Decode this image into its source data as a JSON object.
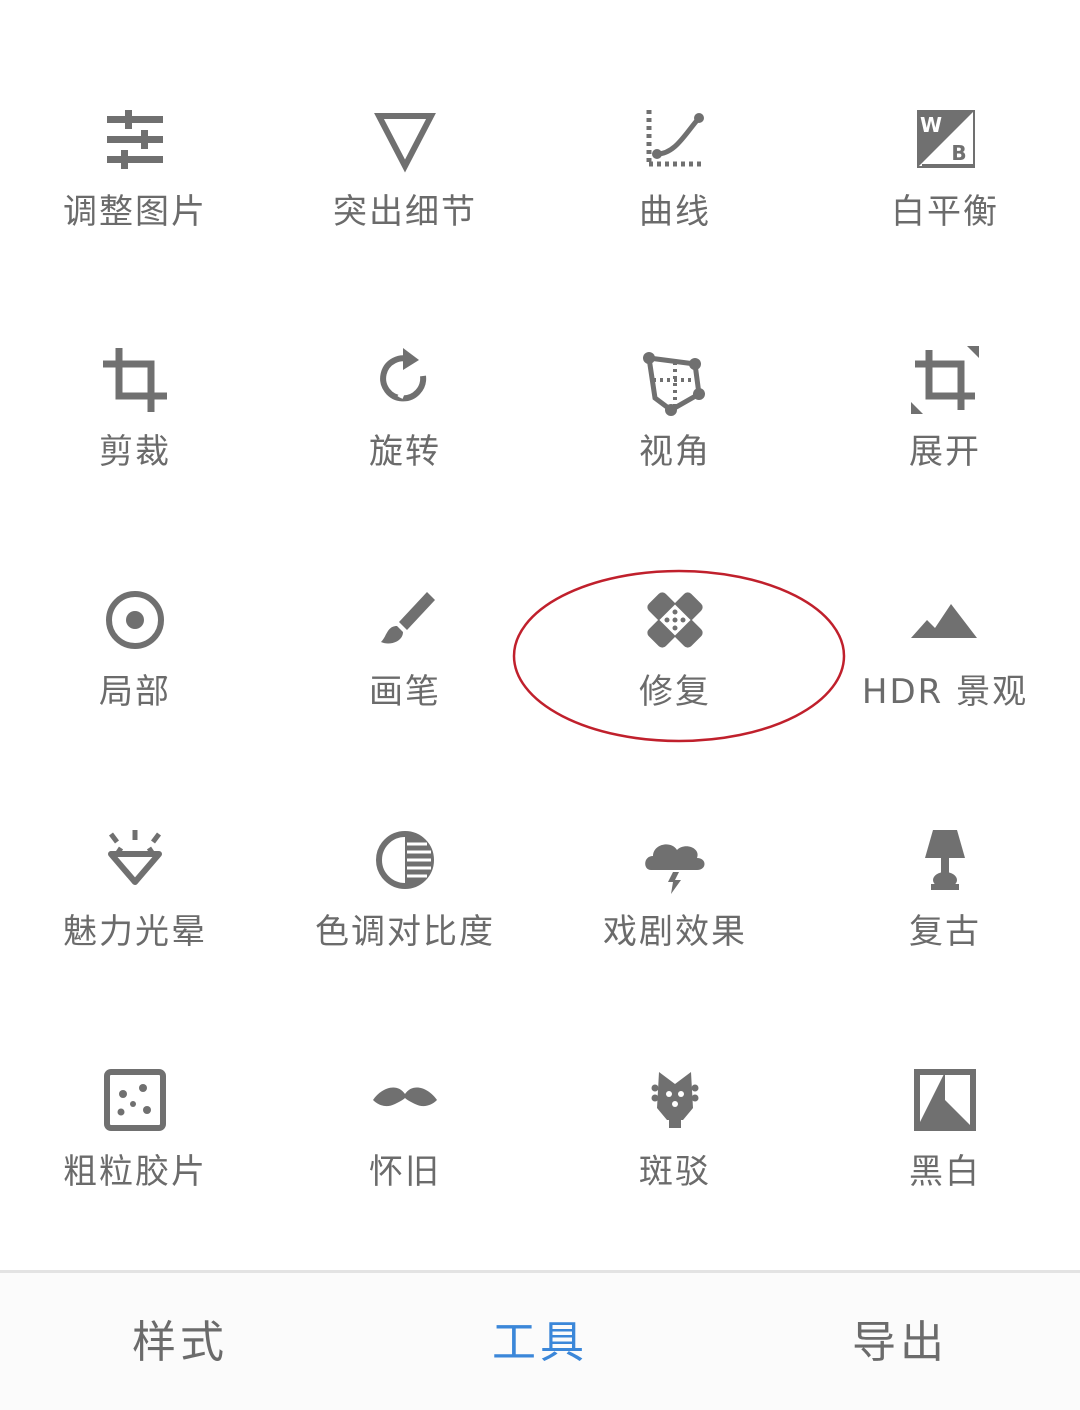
{
  "tools": [
    {
      "label": "调整图片",
      "icon": "tune-sliders-icon"
    },
    {
      "label": "突出细节",
      "icon": "details-triangle-icon"
    },
    {
      "label": "曲线",
      "icon": "curves-icon"
    },
    {
      "label": "白平衡",
      "icon": "white-balance-icon"
    },
    {
      "label": "剪裁",
      "icon": "crop-icon"
    },
    {
      "label": "旋转",
      "icon": "rotate-icon"
    },
    {
      "label": "视角",
      "icon": "perspective-icon"
    },
    {
      "label": "展开",
      "icon": "expand-icon"
    },
    {
      "label": "局部",
      "icon": "selective-target-icon"
    },
    {
      "label": "画笔",
      "icon": "brush-icon"
    },
    {
      "label": "修复",
      "icon": "healing-bandage-icon"
    },
    {
      "label": "HDR 景观",
      "icon": "hdr-mountains-icon"
    },
    {
      "label": "魅力光晕",
      "icon": "glamour-glow-icon"
    },
    {
      "label": "色调对比度",
      "icon": "tonal-contrast-icon"
    },
    {
      "label": "戏剧效果",
      "icon": "drama-cloud-icon"
    },
    {
      "label": "复古",
      "icon": "vintage-lamp-icon"
    },
    {
      "label": "粗粒胶片",
      "icon": "grainy-film-icon"
    },
    {
      "label": "怀旧",
      "icon": "retrolux-mustache-icon"
    },
    {
      "label": "斑驳",
      "icon": "grunge-guitar-icon"
    },
    {
      "label": "黑白",
      "icon": "black-white-icon"
    }
  ],
  "highlighted_tool": "修复",
  "bottom_tabs": [
    {
      "label": "样式",
      "active": false
    },
    {
      "label": "工具",
      "active": true
    },
    {
      "label": "导出",
      "active": false
    }
  ],
  "colors": {
    "icon": "#707070",
    "label": "#6b6b6b",
    "active_tab": "#3b87d9",
    "highlight_circle": "#c0202c"
  }
}
